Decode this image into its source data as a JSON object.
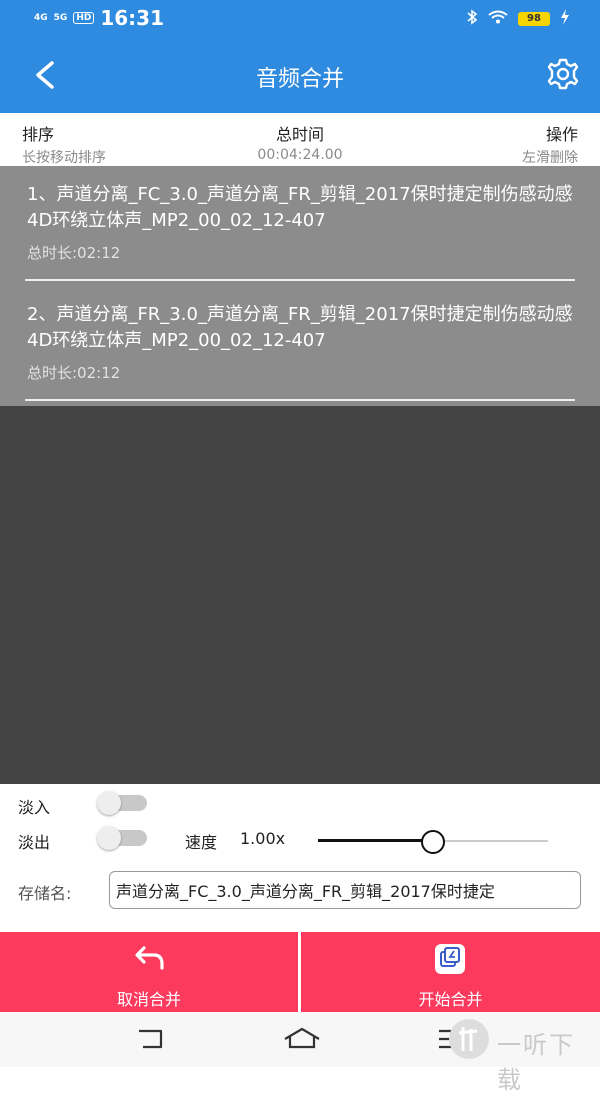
{
  "status_bar": {
    "network_1": "4G",
    "network_2": "5G",
    "hd_badge": "HD",
    "time": "16:31",
    "battery": "98"
  },
  "app_bar": {
    "title": "音频合并"
  },
  "header": {
    "sort_label": "排序",
    "sort_hint": "长按移动排序",
    "total_time_label": "总时间",
    "total_time_value": "00:04:24.00",
    "action_label": "操作",
    "action_hint": "左滑删除"
  },
  "tracks": [
    {
      "title": "1、声道分离_FC_3.0_声道分离_FR_剪辑_2017保时捷定制伤感动感4D环绕立体声_MP2_00_02_12-407",
      "duration": "总时长:02:12"
    },
    {
      "title": "2、声道分离_FR_3.0_声道分离_FR_剪辑_2017保时捷定制伤感动感4D环绕立体声_MP2_00_02_12-407",
      "duration": "总时长:02:12"
    }
  ],
  "controls": {
    "fade_in_label": "淡入",
    "fade_in_enabled": false,
    "fade_out_label": "淡出",
    "fade_out_enabled": false,
    "speed_label": "速度",
    "speed_value": "1.00x",
    "speed_slider_fraction": 0.5,
    "save_name_label": "存储名:",
    "save_name_value": "声道分离_FC_3.0_声道分离_FR_剪辑_2017保时捷定"
  },
  "buttons": {
    "cancel_label": "取消合并",
    "start_label": "开始合并"
  },
  "watermark": "一听下载",
  "colors": {
    "primary": "#2f8be0",
    "action": "#fb3a5e",
    "list_bg": "#8c8c8c",
    "overlay_bg": "#444444"
  },
  "icons": {
    "back": "back-arrow-icon",
    "settings": "gear-icon",
    "cancel": "undo-icon",
    "start": "merge-icon"
  }
}
